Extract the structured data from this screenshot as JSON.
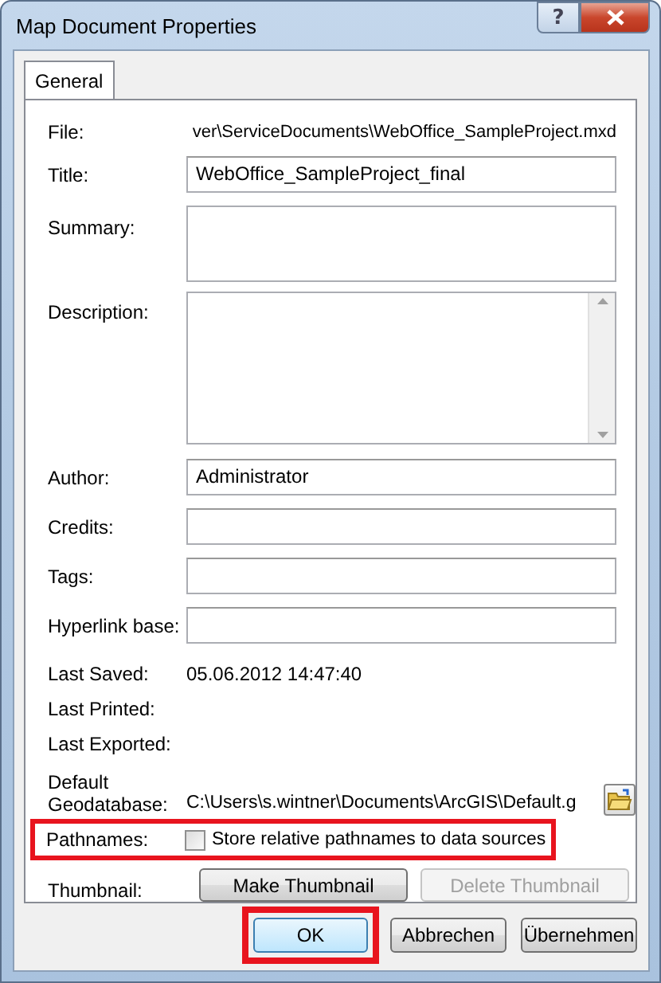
{
  "window": {
    "title": "Map Document Properties",
    "help_button": "?"
  },
  "tabs": [
    {
      "label": "General",
      "selected": true
    }
  ],
  "fields": [
    {
      "kind": "value",
      "label": "File:",
      "value": "ver\\ServiceDocuments\\WebOffice_SampleProject.mxd"
    },
    {
      "kind": "input",
      "label": "Title:",
      "value": "WebOffice_SampleProject_final"
    },
    {
      "kind": "textarea",
      "label": "Summary:"
    },
    {
      "kind": "scrollarea",
      "label": "Description:"
    },
    {
      "kind": "input",
      "label": "Author:",
      "value": "Administrator"
    },
    {
      "kind": "input",
      "label": "Credits:"
    },
    {
      "kind": "input",
      "label": "Tags:"
    },
    {
      "kind": "input",
      "label": "Hyperlink base:"
    },
    {
      "kind": "value",
      "label": "Last Saved:",
      "value": "05.06.2012 14:47:40"
    },
    {
      "kind": "value",
      "label": "Last Printed:"
    },
    {
      "kind": "value",
      "label": "Last Exported:"
    },
    {
      "kind": "path",
      "label": "Default Geodatabase:",
      "value": "C:\\Users\\s.wintner\\Documents\\ArcGIS\\Default.g"
    }
  ],
  "pathnames": {
    "label": "Pathnames:",
    "option": "Store relative pathnames to data sources",
    "checked": false,
    "highlighted": true
  },
  "thumbnail": {
    "label": "Thumbnail:",
    "buttons": [
      {
        "label": "Make Thumbnail",
        "disabled": false
      },
      {
        "label": "Delete Thumbnail",
        "disabled": true
      }
    ]
  },
  "buttons": [
    {
      "label": "OK",
      "default": true,
      "highlighted": true
    },
    {
      "label": "Abbrechen",
      "default": false,
      "highlighted": false
    },
    {
      "label": "Übernehmen",
      "default": false,
      "highlighted": false
    }
  ]
}
